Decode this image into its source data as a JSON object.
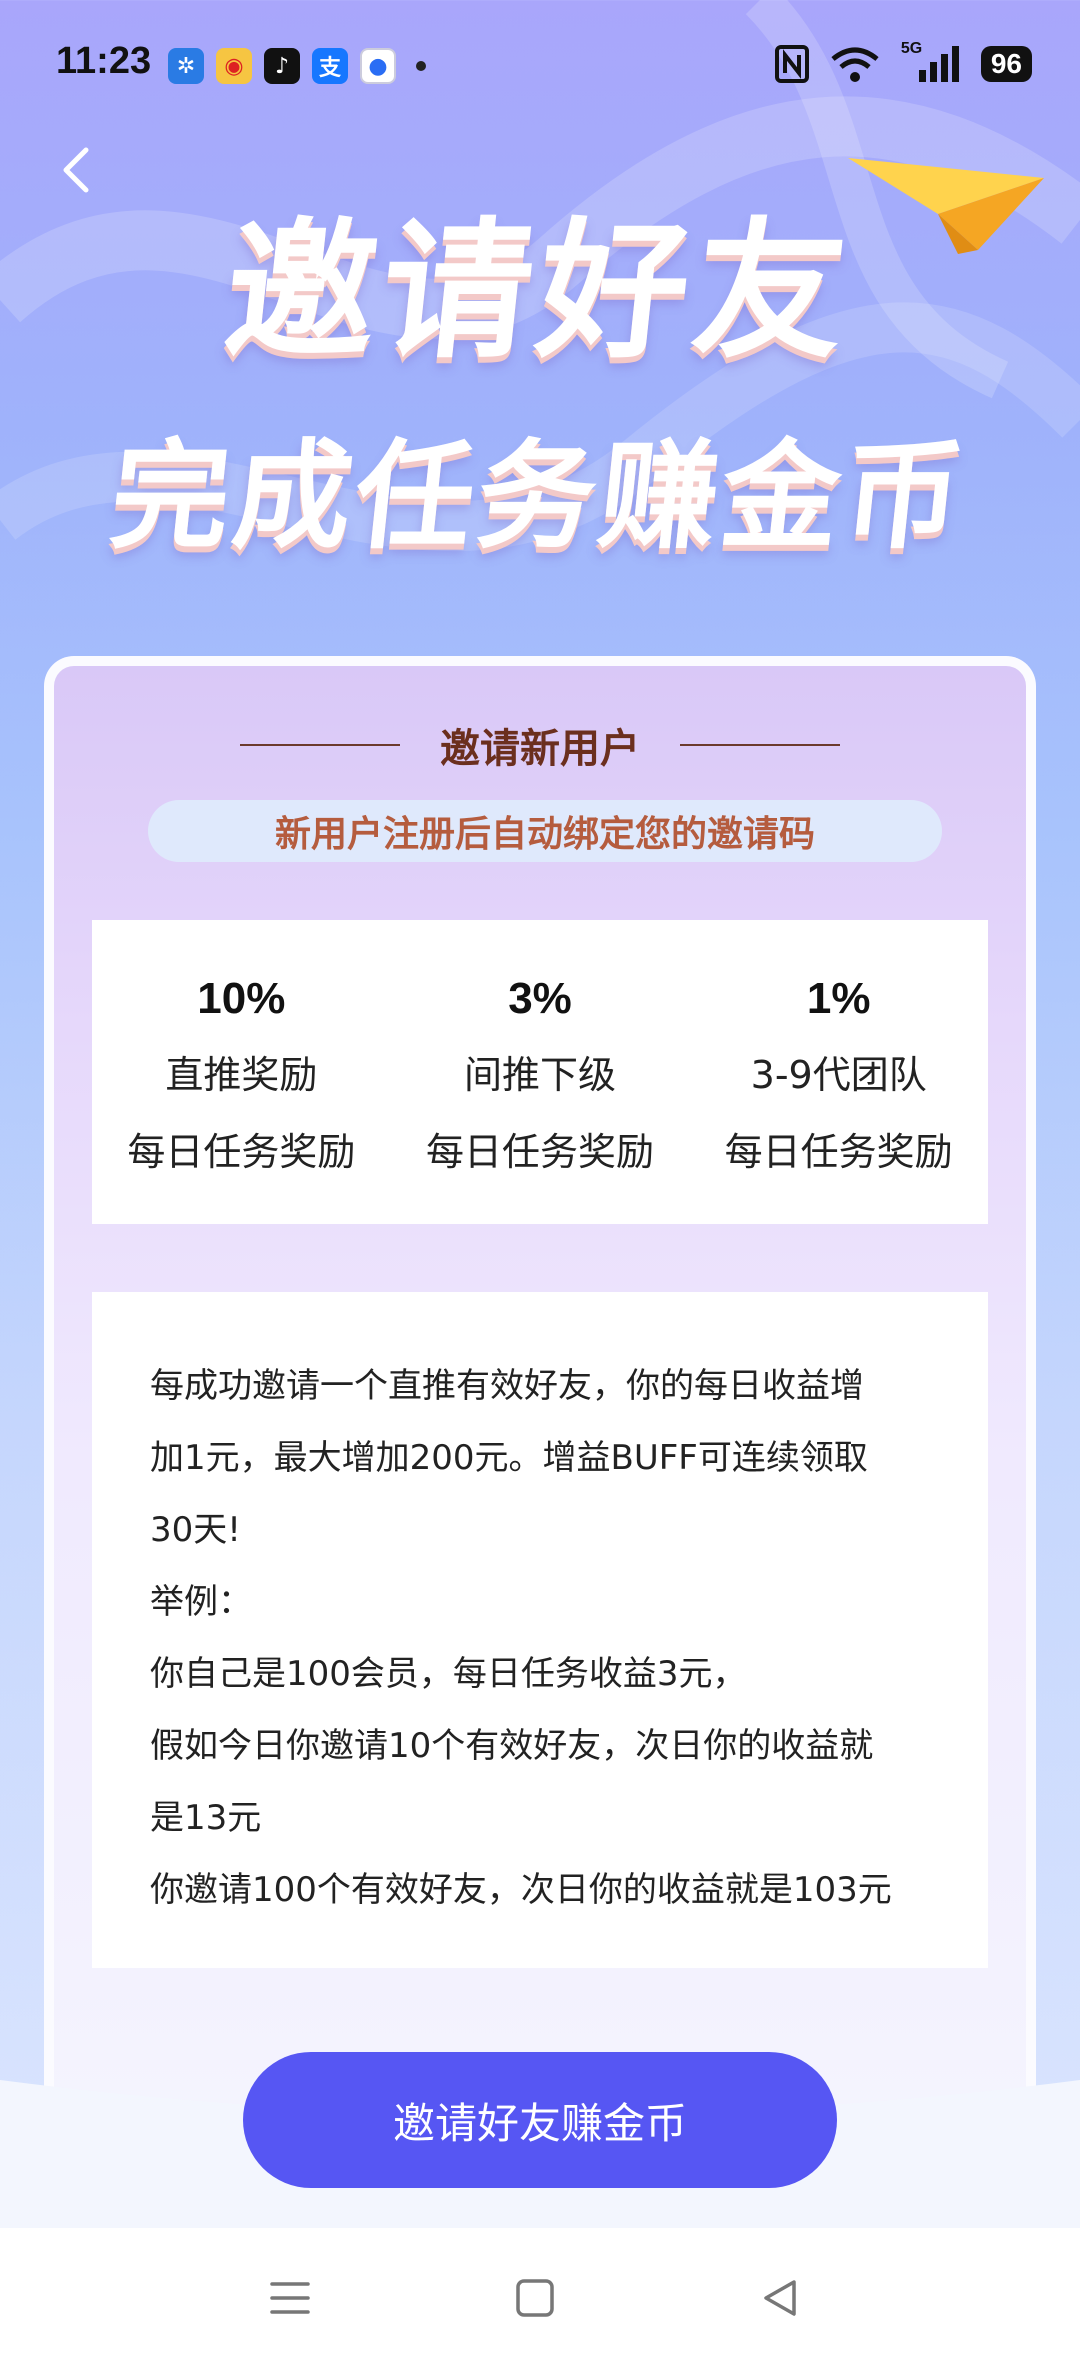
{
  "status_bar": {
    "time": "11:23",
    "network": "5G",
    "battery": "96"
  },
  "hero": {
    "line1": "邀请好友",
    "line2": "完成任务赚金币"
  },
  "card": {
    "section_title": "邀请新用户",
    "subtitle": "新用户注册后自动绑定您的邀请码",
    "rewards": [
      {
        "percent": "10%",
        "label": "直推奖励",
        "sub": "每日任务奖励"
      },
      {
        "percent": "3%",
        "label": "间推下级",
        "sub": "每日任务奖励"
      },
      {
        "percent": "1%",
        "label": "3-9代团队",
        "sub": "每日任务奖励"
      }
    ],
    "info_lines": [
      "每成功邀请一个直推有效好友，你的每日收益增",
      "加1元，最大增加200元。增益BUFF可连续领取",
      "30天!",
      "举例：",
      "你自己是100会员，每日任务收益3元，",
      "假如今日你邀请10个有效好友，次日你的收益就",
      "是13元",
      "你邀请100个有效好友，次日你的收益就是103元"
    ]
  },
  "invite_button": {
    "label": "邀请好友赚金币"
  },
  "colors": {
    "primary_button": "#5656f3",
    "section_title": "#6b2f1e",
    "subtitle_text": "#b55c3e",
    "card_bg_top": "#d9c8f7"
  },
  "icons": {
    "back": "chevron-left-icon",
    "plane": "paper-plane-icon",
    "nav_menu": "menu-icon",
    "nav_home": "square-home-icon",
    "nav_back": "triangle-back-icon"
  }
}
